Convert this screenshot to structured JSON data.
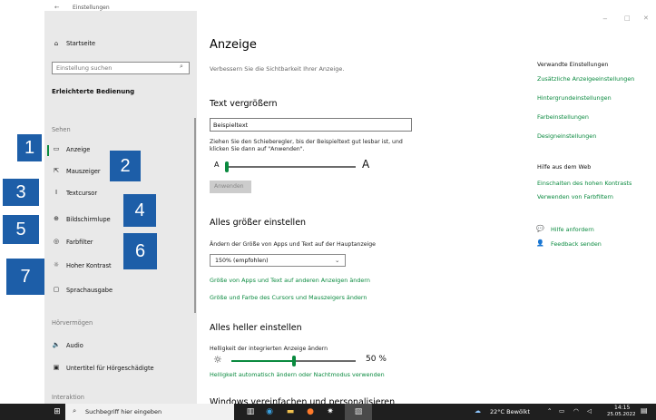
{
  "window": {
    "back_glyph": "←",
    "title": "Einstellungen",
    "min_glyph": "−",
    "max_glyph": "□",
    "close_glyph": "✕"
  },
  "sidebar": {
    "home_label": "Startseite",
    "search_placeholder": "Einstellung suchen",
    "category": "Erleichterte Bedienung",
    "section_sehen": "Sehen",
    "items": [
      {
        "label": "Anzeige",
        "icon": "monitor-icon",
        "glyph": "▭"
      },
      {
        "label": "Mauszeiger",
        "icon": "mouse-pointer-icon",
        "glyph": "⇱"
      },
      {
        "label": "Textcursor",
        "icon": "text-cursor-icon",
        "glyph": "I"
      },
      {
        "label": "Bildschirmlupe",
        "icon": "magnifier-icon",
        "glyph": "⊕"
      },
      {
        "label": "Farbfilter",
        "icon": "color-filter-icon",
        "glyph": "◎"
      },
      {
        "label": "Hoher Kontrast",
        "icon": "high-contrast-icon",
        "glyph": "☼"
      },
      {
        "label": "Sprachausgabe",
        "icon": "narrator-icon",
        "glyph": "▢"
      }
    ],
    "section_hoeren": "Hörvermögen",
    "hoeren_items": [
      {
        "label": "Audio",
        "icon": "speaker-icon",
        "glyph": "🔈"
      },
      {
        "label": "Untertitel für Hörgeschädigte",
        "icon": "captions-icon",
        "glyph": "▣"
      }
    ],
    "section_interaktion": "Interaktion"
  },
  "overlay_numbers": [
    "1",
    "2",
    "3",
    "4",
    "5",
    "6",
    "7"
  ],
  "main": {
    "title": "Anzeige",
    "subtitle": "Verbessern Sie die Sichtbarkeit Ihrer Anzeige.",
    "text_section": {
      "heading": "Text vergrößern",
      "sample_text": "Beispieltext",
      "instructions_line1": "Ziehen Sie den Schieberegler, bis der Beispieltext gut lesbar ist, und",
      "instructions_line2": "klicken Sie dann auf \"Anwenden\".",
      "slider_min_label": "A",
      "slider_max_label": "A",
      "slider_fraction": 0.0,
      "apply_label": "Anwenden"
    },
    "size_section": {
      "heading": "Alles größer einstellen",
      "description": "Ändern der Größe von Apps und Text auf der Hauptanzeige",
      "selected": "150% (empfohlen)",
      "link1": "Größe von Apps und Text auf anderen Anzeigen ändern",
      "link2": "Größe und Farbe des Cursors und Mauszeigers ändern"
    },
    "bright_section": {
      "heading": "Alles heller einstellen",
      "description": "Helligkeit der integrierten Anzeige ändern",
      "value_label": "50 %",
      "value_fraction": 0.5,
      "link": "Helligkeit automatisch ändern oder Nachtmodus verwenden"
    },
    "next_heading": "Windows vereinfachen und personalisieren"
  },
  "related": {
    "heading": "Verwandte Einstellungen",
    "links": [
      "Zusätzliche Anzeigeeinstellungen",
      "Hintergrundeinstellungen",
      "Farbeinstellungen",
      "Designeinstellungen"
    ],
    "help_heading": "Hilfe aus dem Web",
    "help_links": [
      "Einschalten des hohen Kontrasts",
      "Verwenden von Farbfiltern"
    ],
    "support": [
      {
        "label": "Hilfe anfordern",
        "icon": "help-chat-icon",
        "glyph": "💬"
      },
      {
        "label": "Feedback senden",
        "icon": "feedback-icon",
        "glyph": "👤"
      }
    ]
  },
  "taskbar": {
    "search_placeholder": "Suchbegriff hier eingeben",
    "weather": "22°C Bewölkt",
    "time": "14:15",
    "date": "25.05.2022"
  },
  "colors": {
    "accent": "#0a8a3f",
    "overlay": "#1d5ea8",
    "sidebar_bg": "#e9e9e9",
    "taskbar_bg": "#1f1f1f"
  }
}
